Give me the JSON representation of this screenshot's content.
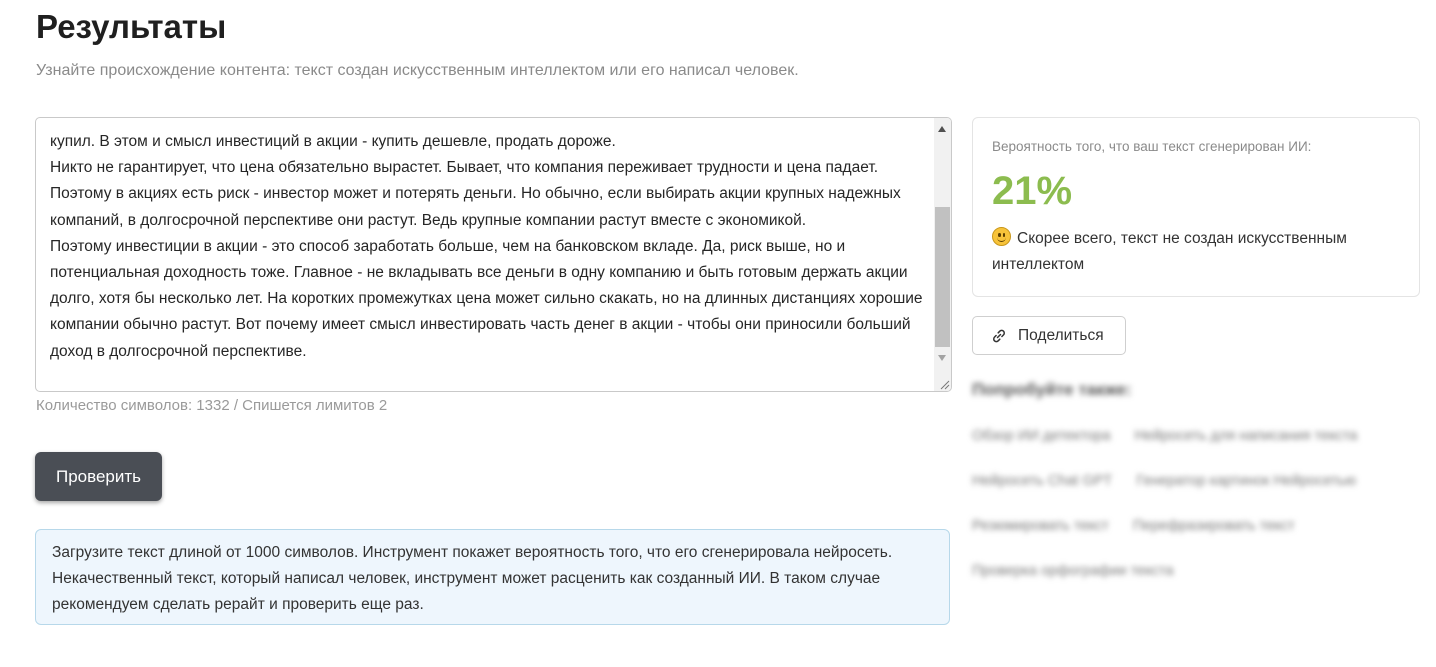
{
  "header": {
    "title": "Результаты",
    "subtitle": "Узнайте происхождение контента: текст создан искусственным интеллектом или его написал человек."
  },
  "editor": {
    "lines": [
      "купил. В этом и смысл инвестиций в акции - купить дешевле, продать дороже.",
      "Никто не гарантирует, что цена обязательно вырастет. Бывает, что компания переживает трудности и цена падает. Поэтому в акциях есть риск - инвестор может и потерять деньги. Но обычно, если выбирать акции крупных надежных компаний, в долгосрочной перспективе они растут. Ведь крупные компании растут вместе с экономикой.",
      "Поэтому инвестиции в акции - это способ заработать больше, чем на банковском вкладе. Да, риск выше, но и потенциальная доходность тоже. Главное - не вкладывать все деньги в одну компанию и быть готовым держать акции долго, хотя бы несколько лет. На коротких промежутках цена может сильно скакать, но на длинных дистанциях хорошие компании обычно растут. Вот почему имеет смысл инвестировать часть денег в акции - чтобы они приносили больший доход в долгосрочной перспективе."
    ],
    "char_count_text": "Количество символов: 1332 / Спишется лимитов 2"
  },
  "actions": {
    "check_label": "Проверить",
    "share_label": "Поделиться"
  },
  "info": {
    "text": "Загрузите текст длиной от 1000 символов. Инструмент покажет вероятность того, что его сгенерировала нейросеть. Некачественный текст, который написал человек, инструмент может расценить как созданный ИИ. В таком случае рекомендуем сделать рерайт и проверить еще раз."
  },
  "result": {
    "label": "Вероятность того, что ваш текст сгенерирован ИИ:",
    "percent": "21%",
    "probability": 0.21,
    "verdict": "Скорее всего, текст не создан искусственным интеллектом",
    "verdict_icon": "smile-icon",
    "accent_color": "#8cbc4f"
  },
  "try_also": {
    "title": "Попробуйте также:",
    "rows": [
      [
        "Обзор ИИ детектора",
        "Нейросеть для написания текста"
      ],
      [
        "Нейросеть Chat GPT",
        "Генератор картинок Нейросетью"
      ],
      [
        "Резюмировать текст",
        "Перефразировать текст"
      ],
      [
        "Проверка орфографии текста"
      ]
    ]
  },
  "colors": {
    "button_bg": "#4a4e55",
    "info_bg": "#eef6fd",
    "info_border": "#b7d8ea"
  }
}
